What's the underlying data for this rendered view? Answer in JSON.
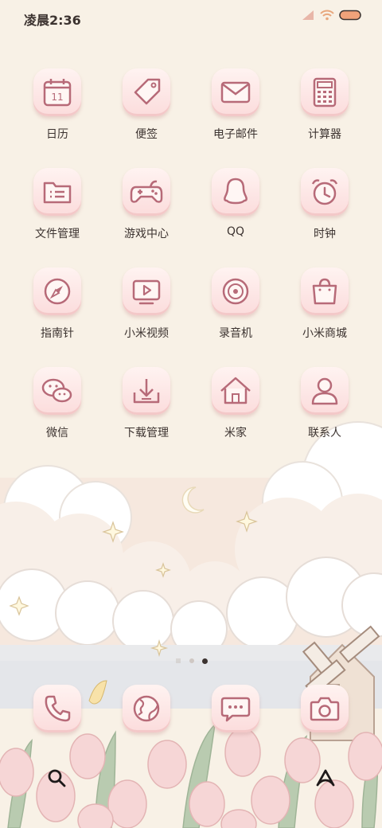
{
  "status_bar": {
    "time": "凌晨2:36",
    "icons": [
      "signal-icon",
      "wifi-icon",
      "battery-icon"
    ]
  },
  "apps": [
    {
      "name": "calendar",
      "label": "日历",
      "icon": "calendar-icon",
      "date_number": "11"
    },
    {
      "name": "notes",
      "label": "便签",
      "icon": "tag-icon"
    },
    {
      "name": "email",
      "label": "电子邮件",
      "icon": "mail-icon"
    },
    {
      "name": "calculator",
      "label": "计算器",
      "icon": "calculator-icon"
    },
    {
      "name": "file-manager",
      "label": "文件管理",
      "icon": "folder-icon"
    },
    {
      "name": "game-center",
      "label": "游戏中心",
      "icon": "gamepad-icon"
    },
    {
      "name": "qq",
      "label": "QQ",
      "icon": "qq-penguin-icon"
    },
    {
      "name": "clock",
      "label": "时钟",
      "icon": "alarm-clock-icon"
    },
    {
      "name": "compass",
      "label": "指南针",
      "icon": "compass-icon"
    },
    {
      "name": "mi-video",
      "label": "小米视频",
      "icon": "video-play-icon"
    },
    {
      "name": "recorder",
      "label": "录音机",
      "icon": "record-disc-icon"
    },
    {
      "name": "mi-store",
      "label": "小米商城",
      "icon": "shopping-bag-icon"
    },
    {
      "name": "wechat",
      "label": "微信",
      "icon": "wechat-icon"
    },
    {
      "name": "download-manager",
      "label": "下载管理",
      "icon": "download-icon"
    },
    {
      "name": "mi-home",
      "label": "米家",
      "icon": "home-icon"
    },
    {
      "name": "contacts",
      "label": "联系人",
      "icon": "person-icon"
    }
  ],
  "page_indicator": {
    "pages": 3,
    "current": 3
  },
  "dock": [
    {
      "name": "phone",
      "icon": "phone-icon"
    },
    {
      "name": "browser",
      "icon": "globe-icon"
    },
    {
      "name": "messages",
      "icon": "message-icon"
    },
    {
      "name": "camera",
      "icon": "camera-icon"
    }
  ],
  "bottom_bar": {
    "left_icon": "search-icon",
    "right_icon": "assistant-icon"
  },
  "colors": {
    "icon_stroke": "#b76a78",
    "tile": "#fbe0df",
    "text": "#3c3330",
    "background": "#f8f1e6"
  }
}
